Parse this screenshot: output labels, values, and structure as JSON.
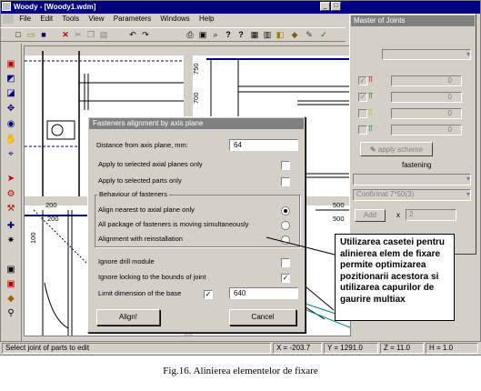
{
  "window": {
    "title": "Woody - [Woody1.wdm]",
    "menu": [
      "File",
      "Edit",
      "Tools",
      "View",
      "Parameters",
      "Windows",
      "Help"
    ]
  },
  "toolbar_icons": [
    "new-icon",
    "open-icon",
    "save-icon",
    "delete-icon",
    "cut-icon",
    "copy-icon",
    "paste-icon",
    "undo-icon",
    "redo-icon",
    "print-icon",
    "preview-icon",
    "zoom-icon",
    "help-icon",
    "context-help-icon",
    "grid-icon",
    "table-icon",
    "layers-icon",
    "cube-icon",
    "wrench-icon",
    "check-icon"
  ],
  "canvas": {
    "ruler_top": [
      "200",
      "500"
    ],
    "ruler_bottom": [
      "200",
      "500"
    ],
    "ruler_side": [
      "750",
      "700",
      "100"
    ]
  },
  "master_panel": {
    "title": "Master of Joints",
    "fields": [
      "0",
      "0",
      "0",
      "0"
    ],
    "apply_button": "apply scheme",
    "fastening_label": "fastening",
    "combo": "Confirmat 7*50(3)",
    "add_button": "Add",
    "x_label": "x",
    "count": "2"
  },
  "dialog": {
    "title": "Fasteners alignment by axis plane",
    "distance_label": "Distance from axis plane, mm:",
    "distance_value": "64",
    "apply_axial": "Apply to selected axial planes only",
    "apply_parts": "Apply to selected parts only",
    "behaviour_title": "Behaviour of fasteners",
    "opt1": "Align nearest to axial plane only",
    "opt2": "All package of fasteners is moving simultaneously",
    "opt3": "Alignment with reinstallation",
    "ignore_drill": "Ignore drill module",
    "ignore_locking": "Ignore locking to the bounds of joint",
    "limit_label": "Limit dimension of the base",
    "limit_value": "640",
    "align_button": "Align!",
    "cancel_button": "Cancel"
  },
  "callout": "Utilizarea casetei pentru alinierea elem de fixare permite optimizarea pozitionarii acestora si utilizarea capurilor de gaurire multiax",
  "status": {
    "message": "Select joint of parts to edit",
    "x": "X = -203.7",
    "y": "Y = 1291.0",
    "z": "Z = 11.0",
    "h": "H = 1.0"
  },
  "caption": "Fig.16. Alinierea elementelor de fixare"
}
